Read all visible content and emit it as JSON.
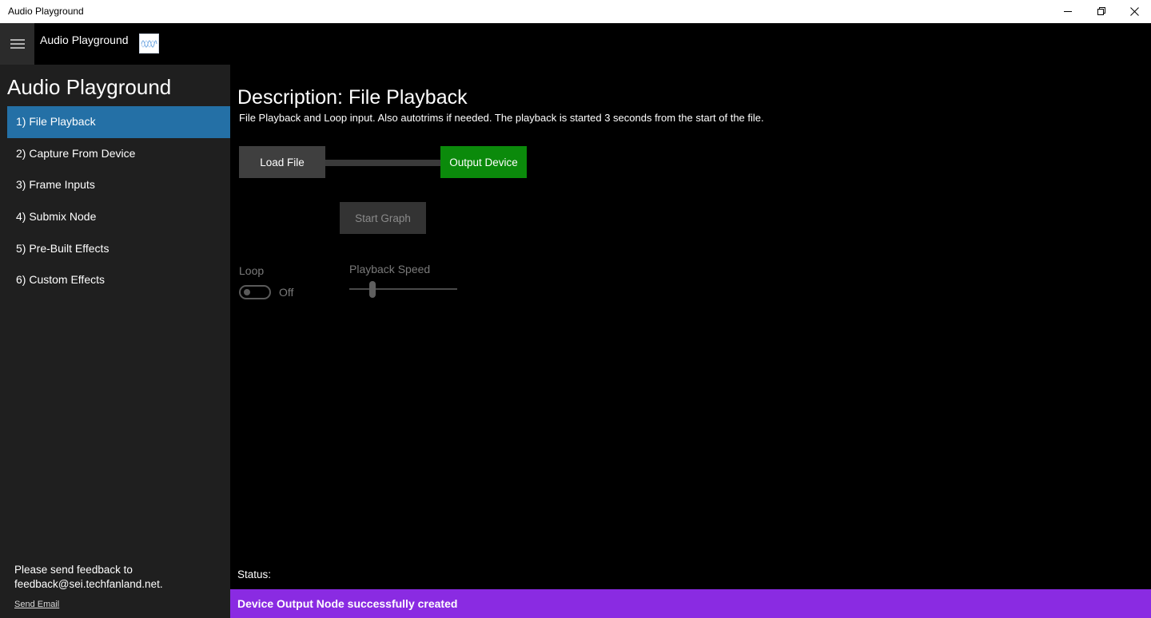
{
  "window": {
    "title": "Audio Playground"
  },
  "header": {
    "app_name": "Audio Playground",
    "menu_icon": "hamburger-icon",
    "logo_icon": "waveform-icon"
  },
  "sidebar": {
    "title": "Audio Playground",
    "items": [
      {
        "label": "1) File Playback",
        "selected": true
      },
      {
        "label": "2) Capture From Device"
      },
      {
        "label": "3) Frame Inputs"
      },
      {
        "label": "4) Submix Node"
      },
      {
        "label": "5) Pre-Built Effects"
      },
      {
        "label": "6) Custom Effects"
      }
    ],
    "feedback_line1": "Please send feedback to",
    "feedback_line2": "feedback@sei.techfanland.net.",
    "send_email": "Send Email"
  },
  "main": {
    "heading": "Description: File Playback",
    "description": "File Playback and Loop input. Also autotrims if needed. The playback is started 3 seconds from the start of the file.",
    "load_file": "Load File",
    "output_device": "Output Device",
    "start_graph": "Start Graph",
    "loop_label": "Loop",
    "loop_state": "Off",
    "playback_speed_label": "Playback Speed",
    "playback_speed_value": 0.2,
    "status_label": "Status:",
    "status_message": "Device Output Node successfully created"
  },
  "colors": {
    "selected_nav": "#2470a6",
    "output_device": "#0b8a0b",
    "status_bar": "#8a2be2"
  }
}
